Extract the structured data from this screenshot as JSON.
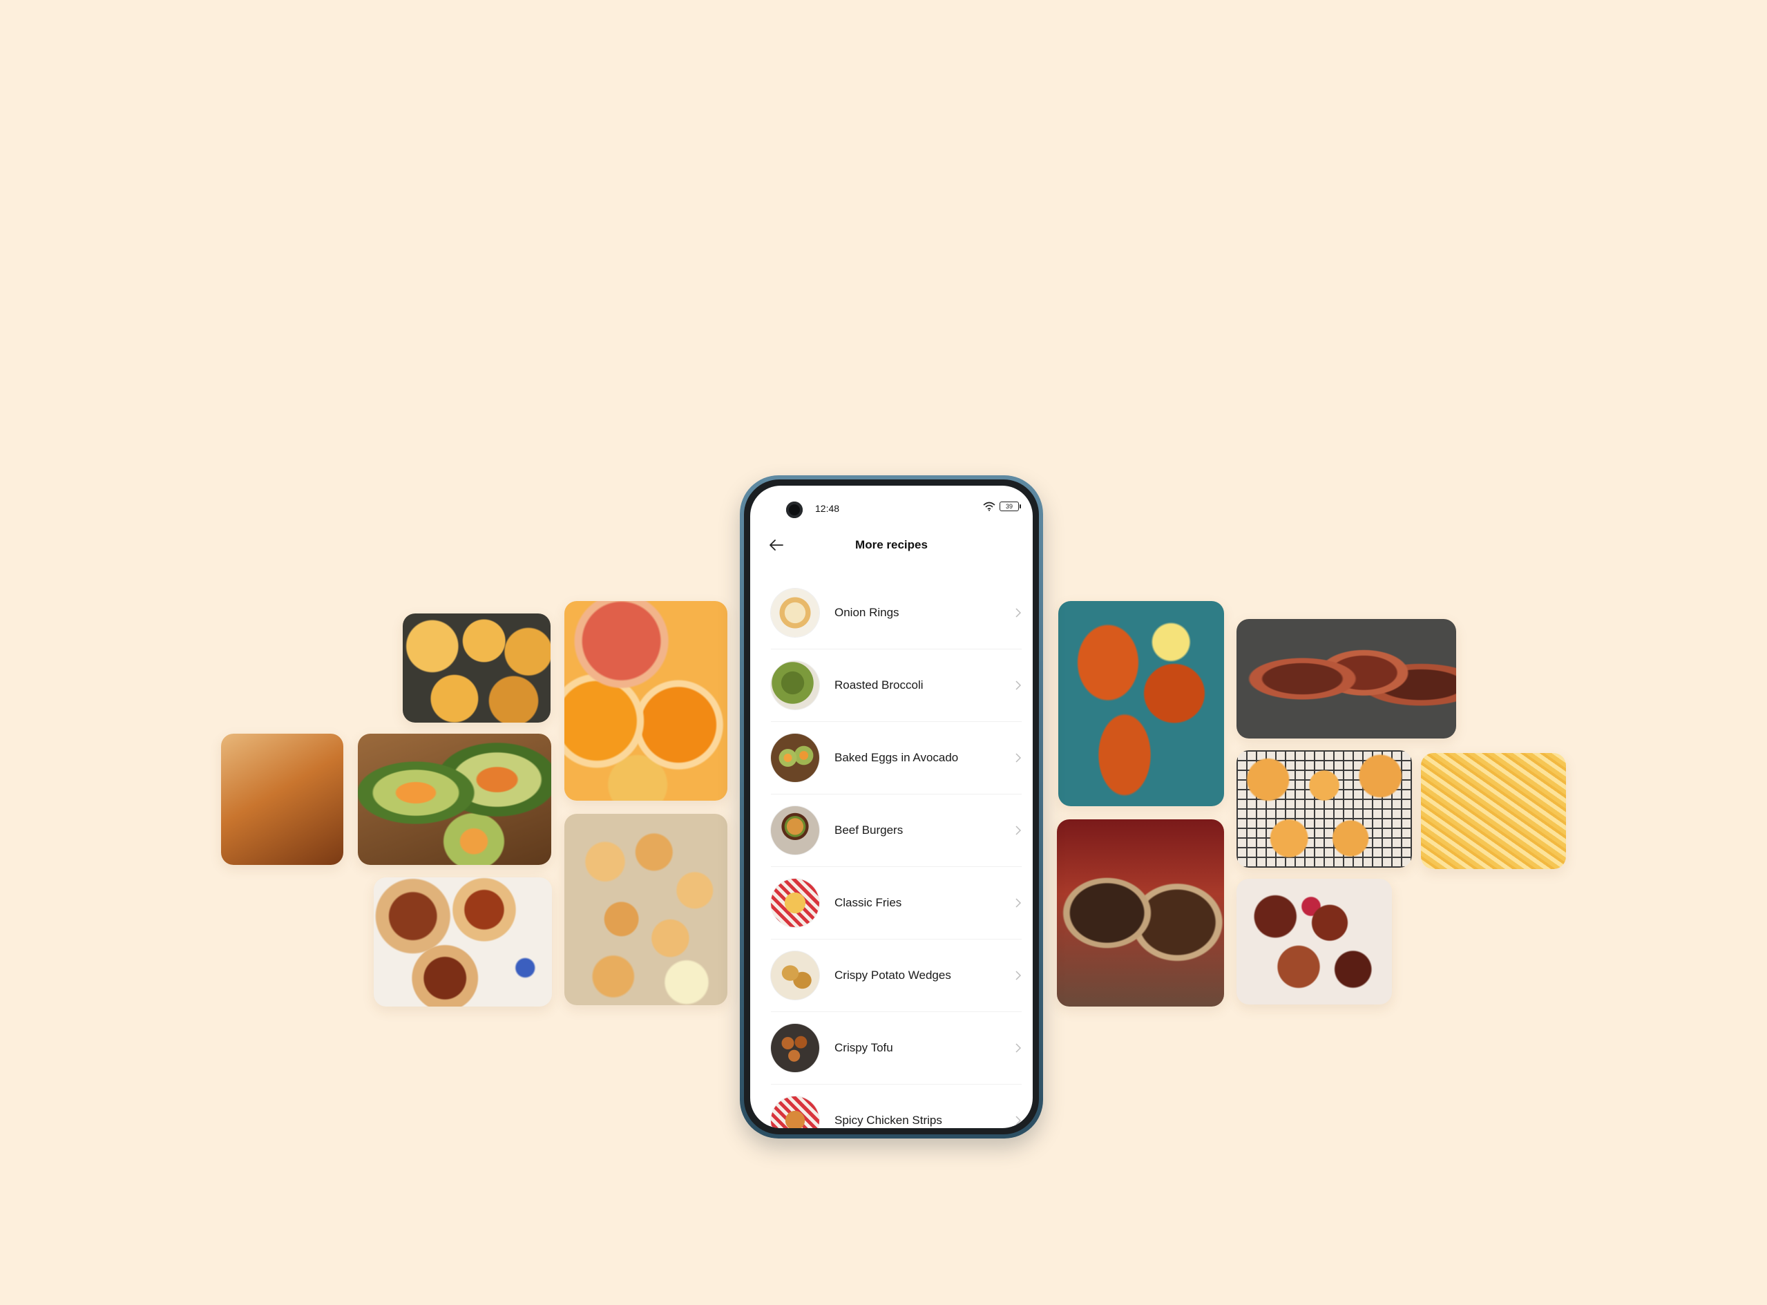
{
  "status_bar": {
    "time": "12:48",
    "battery": "39",
    "icons": [
      "wifi-icon",
      "battery-icon"
    ]
  },
  "app_bar": {
    "title": "More recipes",
    "back_icon": "arrow-left-icon"
  },
  "recipes": [
    {
      "label": "Onion Rings"
    },
    {
      "label": "Roasted Broccoli"
    },
    {
      "label": "Baked Eggs in Avocado"
    },
    {
      "label": "Beef Burgers"
    },
    {
      "label": "Classic Fries"
    },
    {
      "label": "Crispy Potato Wedges"
    },
    {
      "label": "Crispy Tofu"
    },
    {
      "label": "Spicy Chicken Strips"
    }
  ],
  "colors": {
    "page_background": "#fdefdc",
    "phone_frame": "#3f6a82",
    "screen_background": "#ffffff"
  }
}
